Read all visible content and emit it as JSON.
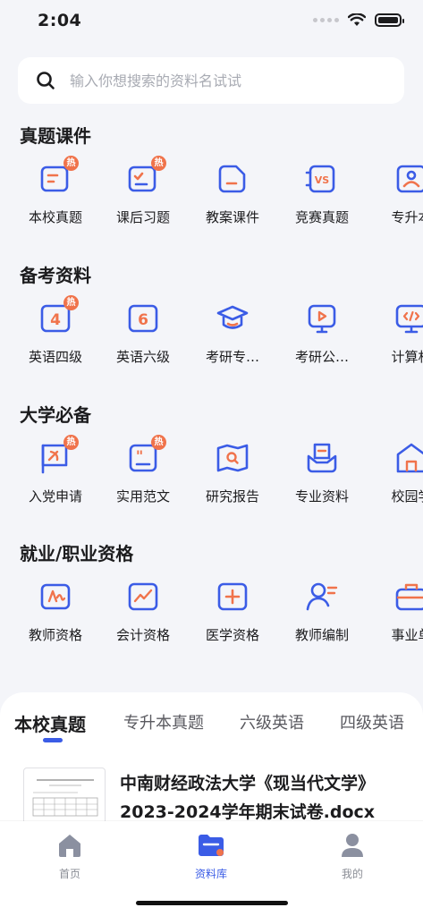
{
  "status": {
    "time": "2:04"
  },
  "search": {
    "placeholder": "输入你想搜索的资料名试试"
  },
  "sections": [
    {
      "title": "真题课件",
      "items": [
        {
          "label": "本校真题",
          "icon": "doc-pencil-icon",
          "hot": "热"
        },
        {
          "label": "课后习题",
          "icon": "checklist-icon",
          "hot": "热"
        },
        {
          "label": "教案课件",
          "icon": "file-icon"
        },
        {
          "label": "竞赛真题",
          "icon": "vs-icon"
        },
        {
          "label": "专升本",
          "icon": "person-card-icon"
        }
      ]
    },
    {
      "title": "备考资料",
      "items": [
        {
          "label": "英语四级",
          "icon": "level-4-icon",
          "hot": "热",
          "glyph": "4"
        },
        {
          "label": "英语六级",
          "icon": "level-6-icon",
          "glyph": "6"
        },
        {
          "label": "考研专…",
          "icon": "graduation-cap-icon"
        },
        {
          "label": "考研公…",
          "icon": "video-screen-icon"
        },
        {
          "label": "计算机",
          "icon": "code-monitor-icon"
        }
      ]
    },
    {
      "title": "大学必备",
      "items": [
        {
          "label": "入党申请",
          "icon": "party-flag-icon",
          "hot": "热"
        },
        {
          "label": "实用范文",
          "icon": "quote-doc-icon",
          "hot": "热"
        },
        {
          "label": "研究报告",
          "icon": "map-search-icon"
        },
        {
          "label": "专业资料",
          "icon": "inbox-icon"
        },
        {
          "label": "校园学",
          "icon": "school-building-icon"
        }
      ]
    },
    {
      "title": "就业/职业资格",
      "items": [
        {
          "label": "教师资格",
          "icon": "teacher-cert-icon"
        },
        {
          "label": "会计资格",
          "icon": "chart-trend-icon"
        },
        {
          "label": "医学资格",
          "icon": "medical-cross-icon"
        },
        {
          "label": "教师编制",
          "icon": "user-list-icon"
        },
        {
          "label": "事业单",
          "icon": "briefcase-icon"
        }
      ]
    }
  ],
  "tabs": [
    "本校真题",
    "专升本真题",
    "六级英语",
    "四级英语"
  ],
  "active_tab": 0,
  "document": {
    "title": "中南财经政法大学《现当代文学》2023-2024学年期末试卷.docx"
  },
  "tab_bar": [
    {
      "label": "首页",
      "icon": "home-icon"
    },
    {
      "label": "资料库",
      "icon": "folder-icon",
      "active": true
    },
    {
      "label": "我的",
      "icon": "profile-icon"
    }
  ],
  "colors": {
    "primary": "#3b5ce6",
    "accent": "#f0734b"
  }
}
